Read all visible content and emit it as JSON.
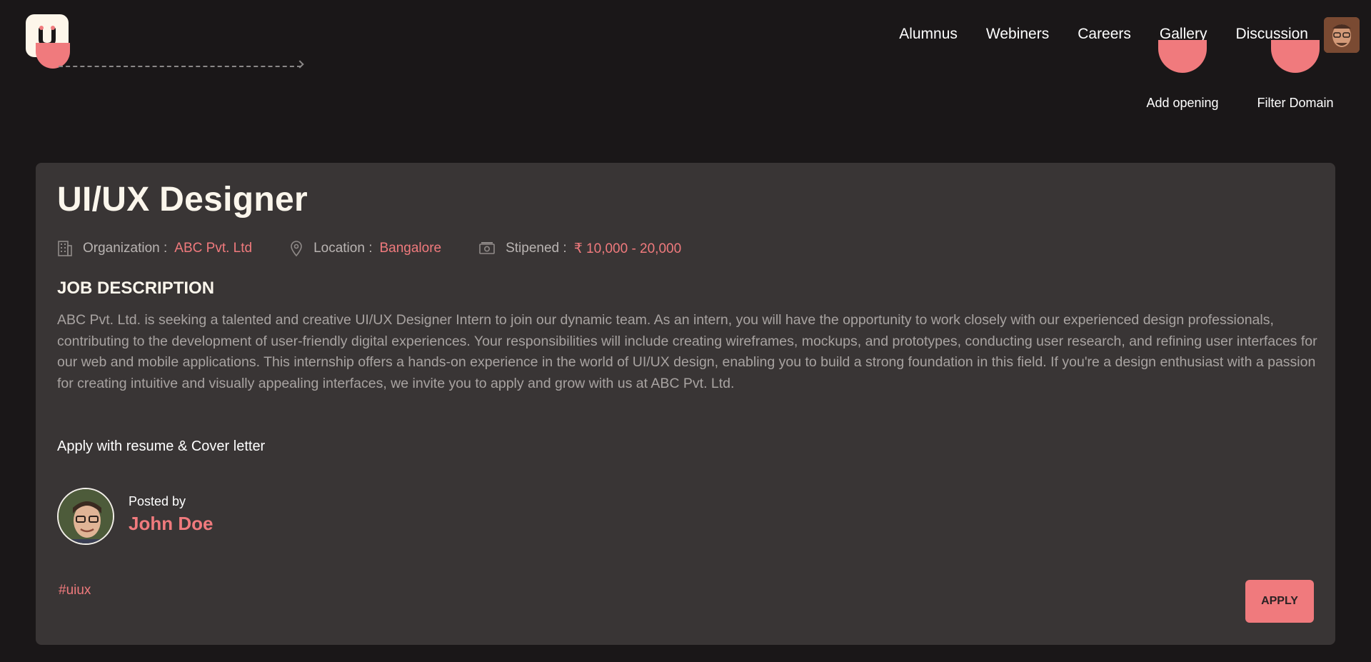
{
  "nav": {
    "items": [
      {
        "label": "Alumnus"
      },
      {
        "label": "Webiners"
      },
      {
        "label": "Careers"
      },
      {
        "label": "Gallery"
      },
      {
        "label": "Discussion"
      }
    ]
  },
  "actions": {
    "add_opening": "Add opening",
    "filter_domain": "Filter Domain"
  },
  "job": {
    "title": "UI/UX Designer",
    "organization_label": "Organization :",
    "organization": "ABC Pvt. Ltd",
    "location_label": "Location :",
    "location": "Bangalore",
    "stipend_label": "Stipened :",
    "stipend": "₹ 10,000 - 20,000",
    "section_heading": "JOB DESCRIPTION",
    "description": "ABC Pvt. Ltd. is seeking a talented and creative UI/UX Designer Intern to join our dynamic team. As an intern, you will have the opportunity to work closely with our experienced design professionals, contributing to the development of user-friendly digital experiences. Your responsibilities will include creating wireframes, mockups, and prototypes, conducting user research, and refining user interfaces for our web and mobile applications. This internship offers a hands-on experience in the world of UI/UX design, enabling you to build a strong foundation in this field. If you're a design enthusiast with a passion for creating intuitive and visually appealing interfaces, we invite you to apply and grow with us at ABC Pvt. Ltd.",
    "apply_note": "Apply with resume & Cover letter",
    "posted_by_label": "Posted by",
    "poster_name": "John Doe",
    "tag": "#uiux",
    "apply_label": "APPLY"
  },
  "colors": {
    "accent": "#f07a7d",
    "background": "#1a1718",
    "card": "#393535"
  }
}
